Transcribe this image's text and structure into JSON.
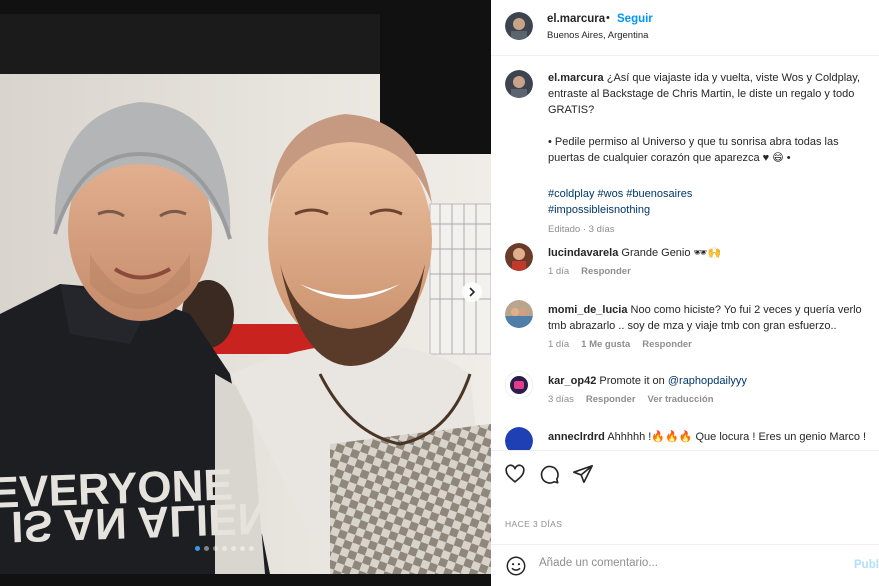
{
  "post": {
    "username": "el.marcura",
    "bullet": "•",
    "follow_label": "Seguir",
    "location": "Buenos Aires, Argentina"
  },
  "caption": {
    "username": "el.marcura",
    "text1": "¿Así que viajaste ida y vuelta, viste Wos y Coldplay, entraste al Backstage de Chris Martin, le diste un regalo y todo GRATIS?",
    "text2": "• Pedile permiso al Universo y que tu sonrisa abra todas las puertas de cualquier corazón que aparezca ♥ 😄 •",
    "tags": [
      "#coldplay",
      "#wos",
      "#buenosaires",
      "#impossibleisnothing"
    ],
    "meta": "Editado · 3 días"
  },
  "comments": [
    {
      "username": "lucindavarela",
      "text": "Grande Genio 🕶🙌",
      "time": "1 día",
      "likes": "",
      "reply": "Responder",
      "translate": ""
    },
    {
      "username": "momi_de_lucia",
      "text": "Noo como hiciste? Yo fui 2 veces y quería verlo tmb abrazarlo .. soy de mza y viaje tmb con gran esfuerzo..",
      "time": "1 día",
      "likes": "1 Me gusta",
      "reply": "Responder",
      "translate": ""
    },
    {
      "username": "kar_op42",
      "text": "Promote it on ",
      "mention": "@raphopdailyyy",
      "time": "3 días",
      "likes": "",
      "reply": "Responder",
      "translate": "Ver traducción"
    },
    {
      "username": "anneclrdrd",
      "text": "Ahhhhh !🔥🔥🔥 Que locura ! Eres un genio Marco !",
      "time": "",
      "likes": "",
      "reply": "",
      "translate": ""
    }
  ],
  "footer": {
    "date": "HACE 3 DÍAS",
    "comment_placeholder": "Añade un comentario...",
    "publish_label": "Publicar"
  },
  "colors": {
    "link_blue": "#0095f6",
    "hashtag": "#00376b",
    "muted": "#8e8e8e"
  },
  "carousel": {
    "slides": 7,
    "active_index": 0
  }
}
